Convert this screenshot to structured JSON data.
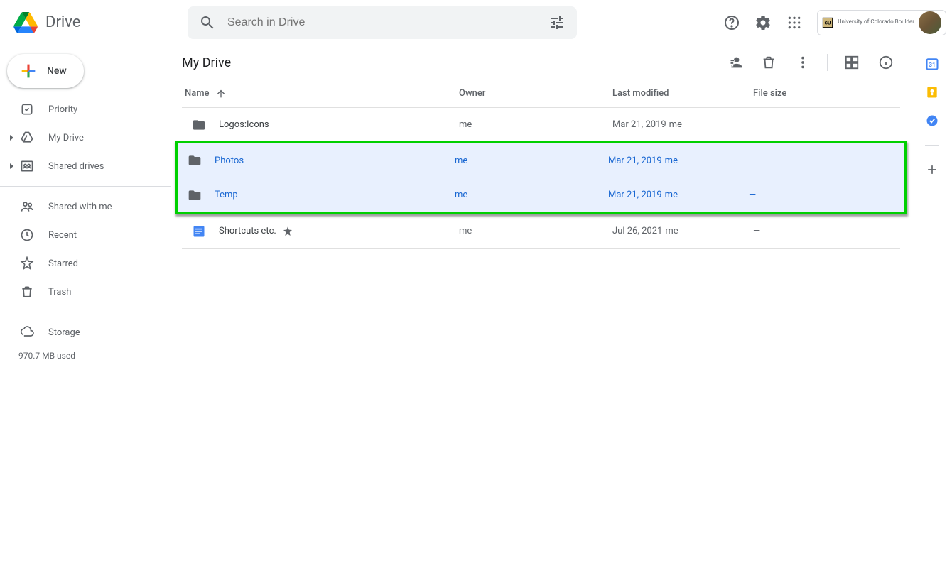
{
  "header": {
    "app_name": "Drive",
    "search_placeholder": "Search in Drive",
    "org_name": "University of Colorado Boulder"
  },
  "sidebar": {
    "new_label": "New",
    "items": [
      {
        "label": "Priority"
      },
      {
        "label": "My Drive"
      },
      {
        "label": "Shared drives"
      },
      {
        "label": "Shared with me"
      },
      {
        "label": "Recent"
      },
      {
        "label": "Starred"
      },
      {
        "label": "Trash"
      },
      {
        "label": "Storage"
      }
    ],
    "storage_used": "970.7 MB used"
  },
  "content": {
    "title": "My Drive",
    "columns": {
      "name": "Name",
      "owner": "Owner",
      "modified": "Last modified",
      "size": "File size"
    },
    "rows": [
      {
        "name": "Logos:Icons",
        "owner": "me",
        "modified_date": "Mar 21, 2019",
        "modified_by": "me",
        "size": "—",
        "type": "folder",
        "selected": false,
        "starred": false
      },
      {
        "name": "Photos",
        "owner": "me",
        "modified_date": "Mar 21, 2019",
        "modified_by": "me",
        "size": "—",
        "type": "folder",
        "selected": true,
        "starred": false
      },
      {
        "name": "Temp",
        "owner": "me",
        "modified_date": "Mar 21, 2019",
        "modified_by": "me",
        "size": "—",
        "type": "folder",
        "selected": true,
        "starred": false
      },
      {
        "name": "Shortcuts etc.",
        "owner": "me",
        "modified_date": "Jul 26, 2021",
        "modified_by": "me",
        "size": "—",
        "type": "doc",
        "selected": false,
        "starred": true
      }
    ]
  }
}
